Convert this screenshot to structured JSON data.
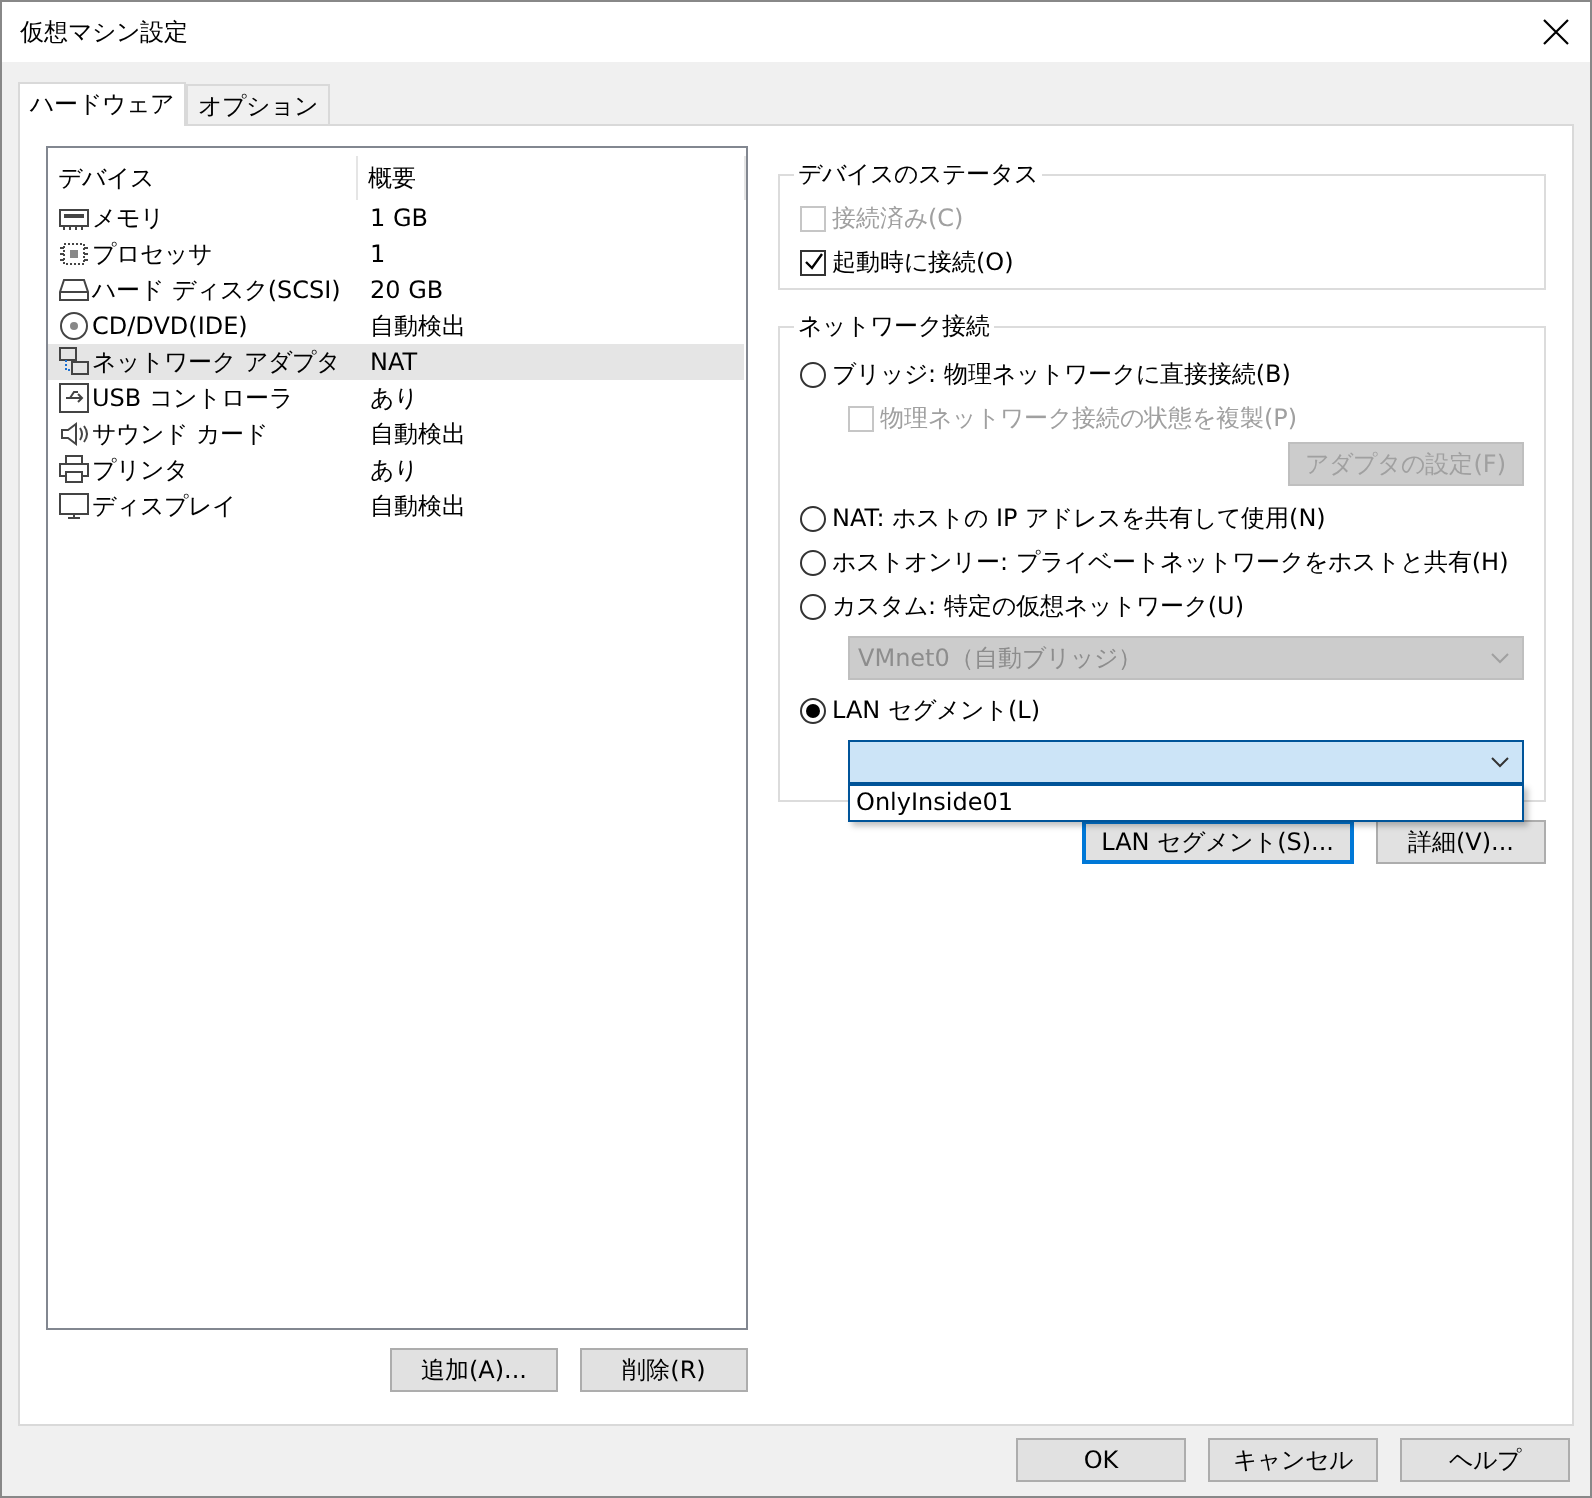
{
  "window": {
    "title": "仮想マシン設定"
  },
  "tabs": [
    {
      "label": "ハードウェア",
      "selected": true
    },
    {
      "label": "オプション",
      "selected": false
    }
  ],
  "device_list": {
    "columns": [
      "デバイス",
      "概要"
    ],
    "rows": [
      {
        "kind": "memory",
        "device": "メモリ",
        "summary": "1 GB",
        "selected": false
      },
      {
        "kind": "processor",
        "device": "プロセッサ",
        "summary": "1",
        "selected": false
      },
      {
        "kind": "disk",
        "device": "ハード ディスク(SCSI)",
        "summary": "20 GB",
        "selected": false
      },
      {
        "kind": "cd",
        "device": "CD/DVD(IDE)",
        "summary": "自動検出",
        "selected": false
      },
      {
        "kind": "network",
        "device": "ネットワーク アダプタ",
        "summary": "NAT",
        "selected": true
      },
      {
        "kind": "usb",
        "device": "USB コントローラ",
        "summary": "あり",
        "selected": false
      },
      {
        "kind": "sound",
        "device": "サウンド カード",
        "summary": "自動検出",
        "selected": false
      },
      {
        "kind": "printer",
        "device": "プリンタ",
        "summary": "あり",
        "selected": false
      },
      {
        "kind": "display",
        "device": "ディスプレイ",
        "summary": "自動検出",
        "selected": false
      }
    ]
  },
  "device_buttons": [
    "追加(A)...",
    "削除(R)"
  ],
  "device_status": {
    "title": "デバイスのステータス",
    "options": [
      {
        "label": "接続済み(C)",
        "checked": false,
        "disabled": true
      },
      {
        "label": "起動時に接続(O)",
        "checked": true,
        "disabled": false
      }
    ]
  },
  "network": {
    "title": "ネットワーク接続",
    "items": [
      {
        "kind": "radio",
        "label": "ブリッジ: 物理ネットワークに直接接続(B)",
        "selected": false
      },
      {
        "kind": "checkbox",
        "label": "物理ネットワーク接続の状態を複製(P)",
        "checked": false,
        "disabled": true
      },
      {
        "kind": "button",
        "label": "アダプタの設定(F)",
        "disabled": true
      },
      {
        "kind": "radio",
        "label": "NAT: ホストの IP アドレスを共有して使用(N)",
        "selected": false
      },
      {
        "kind": "radio",
        "label": "ホストオンリー: プライベートネットワークをホストと共有(H)",
        "selected": false
      },
      {
        "kind": "radio",
        "label": "カスタム: 特定の仮想ネットワーク(U)",
        "selected": false
      },
      {
        "kind": "dropdown",
        "value": "VMnet0（自動ブリッジ）",
        "disabled": true
      },
      {
        "kind": "radio",
        "label": "LAN セグメント(L)",
        "selected": true
      },
      {
        "kind": "dropdown",
        "disabled": false,
        "options": [
          "OnlyInside01"
        ]
      }
    ]
  },
  "panel_buttons": [
    {
      "label": "LAN セグメント(S)...",
      "focused": true
    },
    {
      "label": "詳細(V)...",
      "focused": false
    }
  ],
  "dialog_buttons": [
    "OK",
    "キャンセル",
    "ヘルプ"
  ]
}
